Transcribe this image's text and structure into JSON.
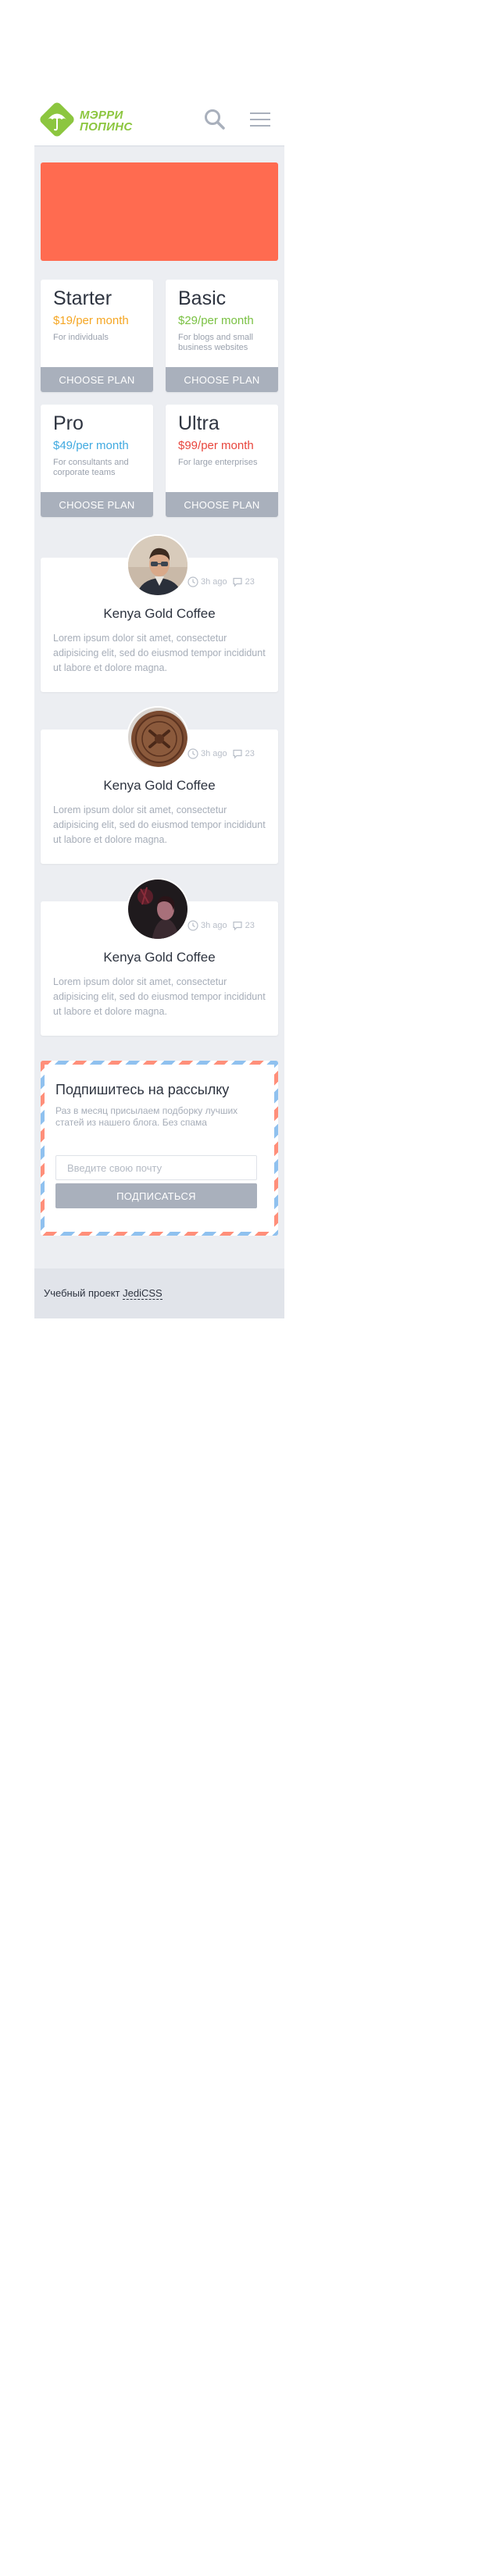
{
  "logo": {
    "line1": "МЭРРИ",
    "line2": "ПОПИНС"
  },
  "header": {
    "search_icon": "search-icon",
    "menu_icon": "hamburger-menu-icon"
  },
  "plans": [
    {
      "name": "Starter",
      "price": "$19/per month",
      "price_color": "#f5a623",
      "desc": "For individuals",
      "button": "CHOOSE PLAN"
    },
    {
      "name": "Basic",
      "price": "$29/per month",
      "price_color": "#7ac143",
      "desc": "For blogs and small business websites",
      "button": "CHOOSE PLAN"
    },
    {
      "name": "Pro",
      "price": "$49/per month",
      "price_color": "#3fa9e0",
      "desc": "For consultants and corporate teams",
      "button": "CHOOSE PLAN"
    },
    {
      "name": "Ultra",
      "price": "$99/per month",
      "price_color": "#e8453c",
      "desc": "For large enterprises",
      "button": "CHOOSE PLAN"
    }
  ],
  "posts": [
    {
      "time": "3h ago",
      "comments": "23",
      "title": "Kenya Gold Coffee",
      "text": "Lorem ipsum dolor sit amet, consectetur adipisicing elit, sed do eiusmod tempor incididunt ut labore et dolore magna."
    },
    {
      "time": "3h ago",
      "comments": "23",
      "title": "Kenya Gold Coffee",
      "text": "Lorem ipsum dolor sit amet, consectetur adipisicing elit, sed do eiusmod tempor incididunt ut labore et dolore magna."
    },
    {
      "time": "3h ago",
      "comments": "23",
      "title": "Kenya Gold Coffee",
      "text": "Lorem ipsum dolor sit amet, consectetur adipisicing elit, sed do eiusmod tempor incididunt ut labore et dolore magna."
    }
  ],
  "subscribe": {
    "title": "Подпишитесь на рассылку",
    "desc": "Раз в месяц присылаем подборку лучших статей из нашего блога. Без спама",
    "placeholder": "Введите свою почту",
    "button": "ПОДПИСАТЬСЯ"
  },
  "footer": {
    "text": "Учебный проект",
    "link": "JediCSS"
  },
  "colors": {
    "accent_green": "#8cc63f",
    "banner": "#ff6b50",
    "button_gray": "#a9b0bc",
    "bg": "#eceef2"
  }
}
